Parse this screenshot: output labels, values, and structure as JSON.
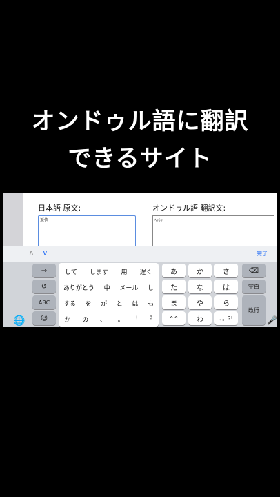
{
  "headline": {
    "line1": "オンドゥル語に翻訳",
    "line2": "できるサイト"
  },
  "page": {
    "source_label": "日本語 原文:",
    "target_label": "オンドゥル語 翻訳文:",
    "source_text": "返信",
    "target_text": "ﾍﾝｼﾝ"
  },
  "accessory": {
    "up": "∧",
    "down": "∨",
    "done": "完了"
  },
  "keyboard": {
    "left_keys": [
      "→",
      "↺",
      "ABC",
      "☺"
    ],
    "suggestions": {
      "row1": [
        "して",
        "します",
        "用",
        "遅く"
      ],
      "row2": [
        "ありがとう",
        "中",
        "メール",
        "し"
      ],
      "row3": [
        "する",
        "を",
        "が",
        "と",
        "は",
        "も"
      ],
      "row4": [
        "か",
        "の",
        "、",
        "。",
        "!",
        "?"
      ]
    },
    "kana": [
      [
        "あ",
        "か",
        "さ"
      ],
      [
        "た",
        "な",
        "は"
      ],
      [
        "ま",
        "や",
        "ら"
      ],
      [
        "^^",
        "わ",
        "、。?!"
      ]
    ],
    "right_keys": {
      "delete": "⌫",
      "space": "空白",
      "return": "改行"
    },
    "globe": "🌐",
    "mic": "🎤"
  }
}
